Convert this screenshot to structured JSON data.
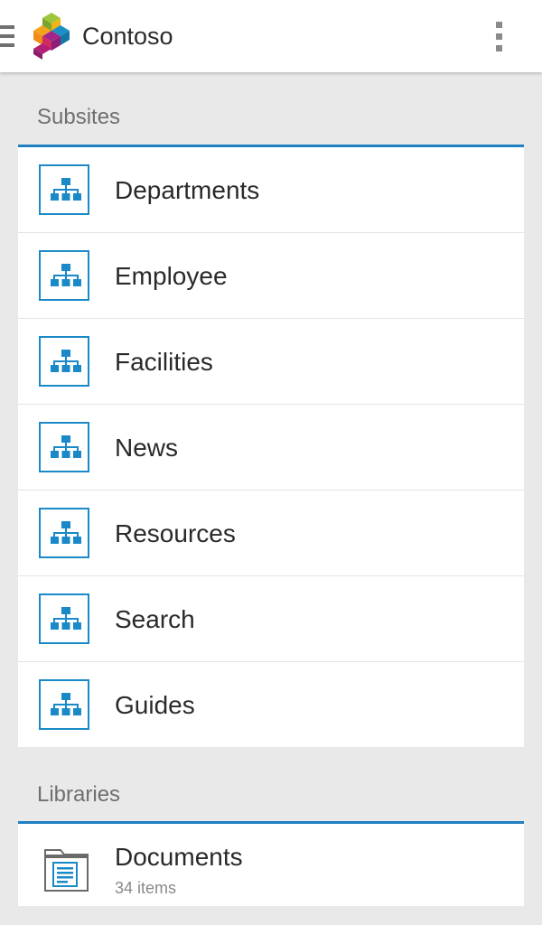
{
  "app": {
    "title": "Contoso",
    "logo_icon": "contoso-logo",
    "menu_icon": "hamburger-menu-icon",
    "overflow_icon": "more-vertical-icon"
  },
  "colors": {
    "accent": "#1e7fc1",
    "icon_blue": "#1a89c7",
    "background": "#e9e9e9"
  },
  "subsites": {
    "header": "Subsites",
    "item_icon": "site-hierarchy-icon",
    "items": [
      {
        "label": "Departments"
      },
      {
        "label": "Employee"
      },
      {
        "label": "Facilities"
      },
      {
        "label": "News"
      },
      {
        "label": "Resources"
      },
      {
        "label": "Search"
      },
      {
        "label": "Guides"
      }
    ]
  },
  "libraries": {
    "header": "Libraries",
    "item_icon": "document-library-icon",
    "items": [
      {
        "label": "Documents",
        "count": "34 items"
      }
    ]
  }
}
